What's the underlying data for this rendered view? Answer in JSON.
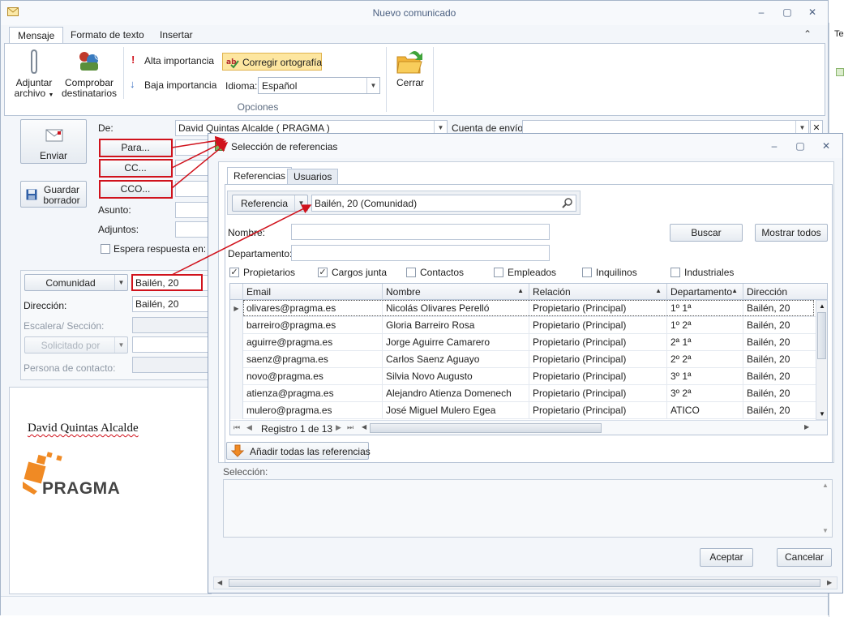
{
  "window": {
    "title": "Nuevo comunicado",
    "minimize": "–",
    "maximize": "▢",
    "close": "✕"
  },
  "ribbon": {
    "tabs": [
      {
        "label": "Mensaje"
      },
      {
        "label": "Formato de texto"
      },
      {
        "label": "Insertar"
      }
    ],
    "collapse": "⌃",
    "attach_line1": "Adjuntar",
    "attach_line2": "archivo",
    "check_line1": "Comprobar",
    "check_line2": "destinatarios",
    "high_importance": "Alta importancia",
    "low_importance": "Baja importancia",
    "spellcheck": "Corregir ortografía",
    "language_label": "Idioma:",
    "language_value": "Español",
    "group_options": "Opciones",
    "close_label": "Cerrar"
  },
  "compose": {
    "send_label": "Enviar",
    "save_line1": "Guardar",
    "save_line2": "borrador",
    "from_label": "De:",
    "from_value": "David Quintas Alcalde ( PRAGMA )",
    "account_label": "Cuenta de envío:",
    "account_value": "",
    "to_button": "Para...",
    "cc_button": "CC...",
    "bcc_button": "CCO...",
    "subject_label": "Asunto:",
    "attachments_label": "Adjuntos:",
    "await_reply_label": "Espera respuesta en:",
    "community_dropdown": "Comunidad",
    "community_value": "Bailén, 20",
    "address_label": "Dirección:",
    "address_value": "Bailén, 20",
    "stair_label": "Escalera/ Sección:",
    "requested_by": "Solicitado por",
    "contact_label": "Persona de contacto:",
    "signature_name": "David Quintas Alcalde",
    "logo_text": "PRAGMA"
  },
  "dialog": {
    "title": "Selección de referencias",
    "tabs": [
      {
        "label": "Referencias"
      },
      {
        "label": "Usuarios"
      }
    ],
    "ref_dropdown": "Referencia",
    "ref_value": "Bailén, 20 (Comunidad)",
    "name_label": "Nombre:",
    "dept_label": "Departamento:",
    "search_button": "Buscar",
    "show_all_button": "Mostrar todos",
    "filters": [
      {
        "label": "Propietarios",
        "checked": true
      },
      {
        "label": "Cargos junta",
        "checked": true
      },
      {
        "label": "Contactos",
        "checked": false
      },
      {
        "label": "Empleados",
        "checked": false
      },
      {
        "label": "Inquilinos",
        "checked": false
      },
      {
        "label": "Industriales",
        "checked": false
      }
    ],
    "columns": [
      "Email",
      "Nombre",
      "Relación",
      "Departamento",
      "Dirección"
    ],
    "rows": [
      {
        "email": "olivares@pragma.es",
        "name": "Nicolás Olivares Perelló",
        "relation": "Propietario (Principal)",
        "dept": "1º 1ª",
        "address": "Bailén, 20"
      },
      {
        "email": "barreiro@pragma.es",
        "name": "Gloria Barreiro Rosa",
        "relation": "Propietario (Principal)",
        "dept": "1º 2ª",
        "address": "Bailén, 20"
      },
      {
        "email": "aguirre@pragma.es",
        "name": "Jorge Aguirre Camarero",
        "relation": "Propietario (Principal)",
        "dept": "2ª 1ª",
        "address": "Bailén, 20"
      },
      {
        "email": "saenz@pragma.es",
        "name": "Carlos Saenz Aguayo",
        "relation": "Propietario (Principal)",
        "dept": "2º 2ª",
        "address": "Bailén, 20"
      },
      {
        "email": "novo@pragma.es",
        "name": "Silvia Novo Augusto",
        "relation": "Propietario (Principal)",
        "dept": "3º 1ª",
        "address": "Bailén, 20"
      },
      {
        "email": "atienza@pragma.es",
        "name": "Alejandro Atienza Domenech",
        "relation": "Propietario (Principal)",
        "dept": "3º 2ª",
        "address": "Bailén, 20"
      },
      {
        "email": "mulero@pragma.es",
        "name": "José Miguel Mulero Egea",
        "relation": "Propietario (Principal)",
        "dept": "ATICO",
        "address": "Bailén, 20"
      }
    ],
    "record_nav": "Registro 1 de 13",
    "add_all_button": "Añadir todas las referencias",
    "selection_label": "Selección:",
    "accept_button": "Aceptar",
    "cancel_button": "Cancelar",
    "minimize": "–",
    "maximize": "▢",
    "close": "✕"
  },
  "behind_window": {
    "tab_label": "Te"
  },
  "colors": {
    "annotation_red": "#d0121c",
    "accent_blue": "#4a5f80"
  },
  "icons": [
    "envelope-icon",
    "paperclip-icon",
    "check-recipients-icon",
    "exclamation-icon",
    "down-arrow-icon",
    "spellcheck-icon",
    "close-folder-icon",
    "send-icon",
    "save-icon",
    "magnifier-icon",
    "add-arrow-icon"
  ]
}
